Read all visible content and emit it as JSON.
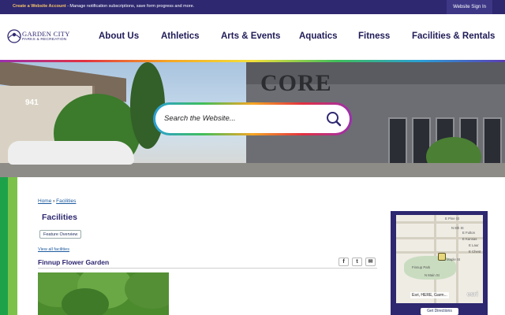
{
  "topbar": {
    "create_link": "Create a Website Account",
    "create_msg": " - Manage notification subscriptions, save form progress and more.",
    "signin": "Website Sign In"
  },
  "logo": {
    "line1": "GARDEN CITY",
    "line2": "PARKS & RECREATION"
  },
  "nav": [
    "About Us",
    "Athletics",
    "Arts & Events",
    "Aquatics",
    "Fitness",
    "Facilities & Rentals"
  ],
  "hero": {
    "house_number": "941",
    "sign": "CORE"
  },
  "search": {
    "placeholder": "Search the Website..."
  },
  "breadcrumb": {
    "home": "Home",
    "separator": "›",
    "current": "Facilities"
  },
  "page_title": "Facilities",
  "feature_button": "Feature Overview",
  "view_all": "View all facilities",
  "facility_title": "Finnup Flower Garden",
  "share": {
    "facebook": "f",
    "twitter": "t",
    "email": "✉"
  },
  "map": {
    "street_labels": [
      "E Pine St",
      "E Laur",
      "E Chest",
      "E Fulton",
      "E Kansas",
      "Finnup Park",
      "N 8th St",
      "N Main St",
      "E Maple St"
    ],
    "attribution": "Esri, HERE, Garm...",
    "brand": "esri",
    "directions": "Get Directions"
  },
  "colors": {
    "primary": "#2e2870",
    "accent_gold": "#f6c46a",
    "green": "#1da24a"
  }
}
